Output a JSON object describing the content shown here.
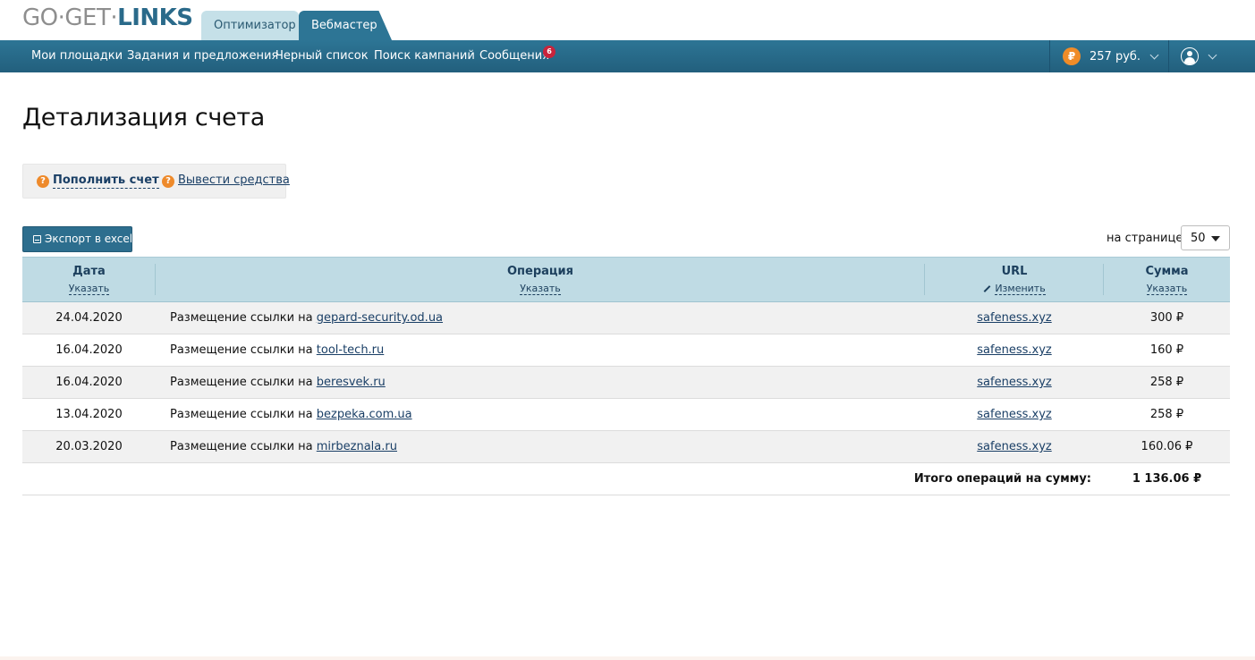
{
  "logo": {
    "part1": "GO",
    "part2": "GET",
    "part3": "LINKS",
    "sep": "·"
  },
  "tabs": [
    {
      "label": "Оптимизатор",
      "active": false
    },
    {
      "label": "Вебмастер",
      "active": true
    }
  ],
  "nav": {
    "items": [
      "Мои площадки",
      "Задания и предложения",
      "Черный список",
      "Поиск кампаний",
      "Сообщения"
    ],
    "messages_badge": "6",
    "balance": "257 руб.",
    "currency_icon": "ruble-coin-icon",
    "currency_symbol": "₽"
  },
  "page": {
    "title": "Детализация счета"
  },
  "actions": {
    "deposit": "Пополнить счет",
    "withdraw": "Вывести средства",
    "help_symbol": "?"
  },
  "toolbar": {
    "export_label": "Экспорт в excel",
    "per_page_label": "на странице",
    "per_page_value": "50"
  },
  "table": {
    "headers": {
      "date": "Дата",
      "date_action": "Указать",
      "operation": "Операция",
      "operation_action": "Указать",
      "url": "URL",
      "url_action": "Изменить",
      "sum": "Сумма",
      "sum_action": "Указать"
    },
    "rows": [
      {
        "date": "24.04.2020",
        "op_prefix": "Размещение ссылки на",
        "op_link": "gepard-security.od.ua",
        "url": "safeness.xyz",
        "sum": "300 ₽"
      },
      {
        "date": "16.04.2020",
        "op_prefix": "Размещение ссылки на",
        "op_link": "tool-tech.ru",
        "url": "safeness.xyz",
        "sum": "160 ₽"
      },
      {
        "date": "16.04.2020",
        "op_prefix": "Размещение ссылки на",
        "op_link": "beresvek.ru",
        "url": "safeness.xyz",
        "sum": "258 ₽"
      },
      {
        "date": "13.04.2020",
        "op_prefix": "Размещение ссылки на",
        "op_link": "bezpeka.com.ua",
        "url": "safeness.xyz",
        "sum": "258 ₽"
      },
      {
        "date": "20.03.2020",
        "op_prefix": "Размещение ссылки на",
        "op_link": "mirbeznala.ru",
        "url": "safeness.xyz",
        "sum": "160.06 ₽"
      }
    ],
    "total_label": "Итого операций на сумму:",
    "total_value": "1 136.06 ₽"
  },
  "colors": {
    "brand": "#2d7595",
    "header_row": "#bfdbe4",
    "link": "#1a3f66",
    "accent_orange": "#ee8a2b",
    "badge_red": "#c8243c"
  }
}
